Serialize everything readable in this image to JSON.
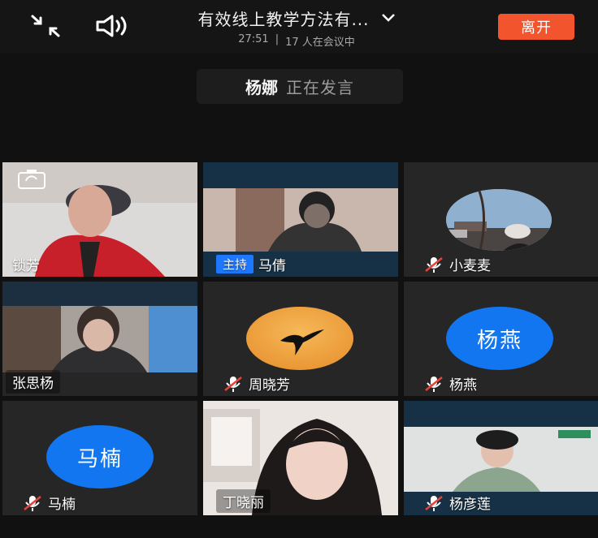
{
  "meeting": {
    "title": "有效线上教学方法有...",
    "elapsed": "27:51",
    "separator": "|",
    "participants": "17 人在会议中",
    "leave_label": "离开"
  },
  "speaking": {
    "name": "杨娜",
    "status": "正在发言"
  },
  "host_badge": "主持",
  "tiles": [
    {
      "name": "锁芳"
    },
    {
      "name": "马倩"
    },
    {
      "name": "小麦麦"
    },
    {
      "name": "张思杨"
    },
    {
      "name": "周晓芳"
    },
    {
      "name": "杨燕",
      "avatar": "杨燕"
    },
    {
      "name": "马楠",
      "avatar": "马楠"
    },
    {
      "name": "丁晓丽"
    },
    {
      "name": "杨彦莲"
    }
  ],
  "colors": {
    "accent": "#f2542d",
    "host_blue": "#1e78ff",
    "avatar_blue": "#1176f0",
    "mic_off_red": "#e8433b"
  },
  "icons": [
    "shrink-icon",
    "speaker-icon",
    "chevron-down-icon",
    "mic-off-icon",
    "camera-switch-icon"
  ]
}
